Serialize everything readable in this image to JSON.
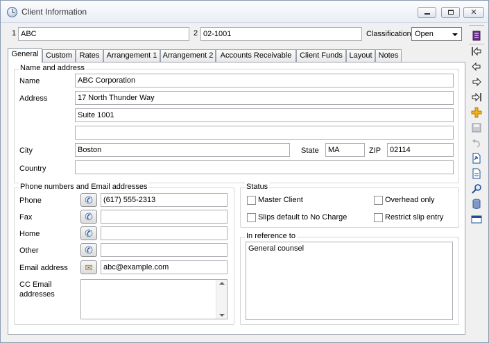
{
  "window": {
    "title": "Client Information"
  },
  "header": {
    "field1_label": "1",
    "field1_value": "ABC",
    "field2_label": "2",
    "field2_value": "02-1001",
    "classification_label": "Classification",
    "classification_value": "Open"
  },
  "tabs": [
    {
      "label": "General",
      "active": true
    },
    {
      "label": "Custom"
    },
    {
      "label": "Rates"
    },
    {
      "label": "Arrangement 1"
    },
    {
      "label": "Arrangement 2"
    },
    {
      "label": "Accounts Receivable"
    },
    {
      "label": "Client Funds"
    },
    {
      "label": "Layout"
    },
    {
      "label": "Notes"
    }
  ],
  "address": {
    "group_title": "Name and address",
    "name_label": "Name",
    "name_value": "ABC Corporation",
    "address_label": "Address",
    "address_line1": "17 North Thunder Way",
    "address_line2": "Suite 1001",
    "address_line3": "",
    "city_label": "City",
    "city_value": "Boston",
    "state_label": "State",
    "state_value": "MA",
    "zip_label": "ZIP",
    "zip_value": "02114",
    "country_label": "Country",
    "country_value": ""
  },
  "contact": {
    "group_title": "Phone numbers and Email addresses",
    "phone_label": "Phone",
    "phone_value": "(617) 555-2313",
    "fax_label": "Fax",
    "fax_value": "",
    "home_label": "Home",
    "home_value": "",
    "other_label": "Other",
    "other_value": "",
    "email_label": "Email address",
    "email_value": "abc@example.com",
    "cc_label_line1": "CC Email",
    "cc_label_line2": "addresses",
    "cc_value": ""
  },
  "status": {
    "group_title": "Status",
    "master_client_label": "Master Client",
    "overhead_only_label": "Overhead only",
    "slips_default_label": "Slips default to No Charge",
    "restrict_slip_label": "Restrict slip entry"
  },
  "reference": {
    "group_title": "In reference to",
    "value": "General counsel"
  },
  "toolbar_icons": [
    "list-icon",
    "first-record-icon",
    "previous-record-icon",
    "next-record-icon",
    "last-record-icon",
    "add-icon",
    "save-icon",
    "undo-icon",
    "export-icon",
    "report-icon",
    "search-icon",
    "database-icon",
    "window-icon"
  ],
  "colors": {
    "accent": "#3a6fb0",
    "window_border": "#8a9bb0",
    "tab_border": "#9aa3ad"
  }
}
